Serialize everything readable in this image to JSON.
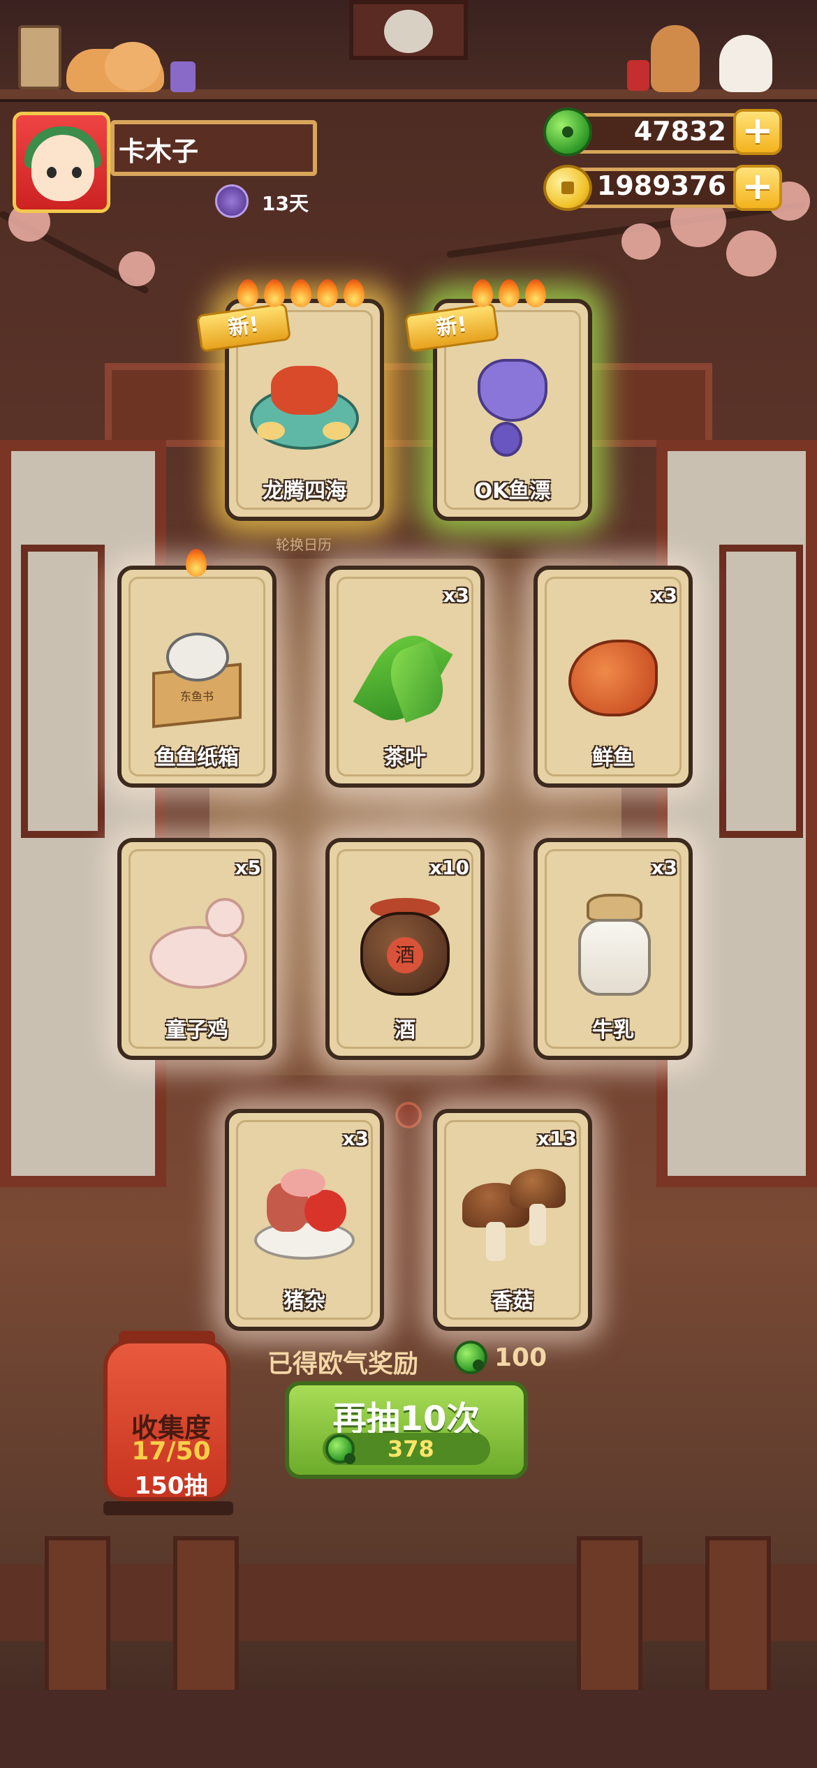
{
  "profile": {
    "name": "卡木子",
    "days": "13天"
  },
  "currency": {
    "jade": "47832",
    "coins": "1989376"
  },
  "featured": [
    {
      "label": "龙腾四海",
      "badge": "新",
      "flames": 5
    },
    {
      "label": "OK鱼漂",
      "badge": "新",
      "flames": 3
    }
  ],
  "calendar_label": "轮换日历",
  "cards": [
    {
      "label": "鱼鱼纸箱",
      "qty": "",
      "flame": true
    },
    {
      "label": "茶叶",
      "qty": "x3"
    },
    {
      "label": "鲜鱼",
      "qty": "x3"
    },
    {
      "label": "童子鸡",
      "qty": "x5"
    },
    {
      "label": "酒",
      "qty": "x10"
    },
    {
      "label": "牛乳",
      "qty": "x3"
    },
    {
      "label": "猪杂",
      "qty": "x3"
    },
    {
      "label": "香菇",
      "qty": "x13"
    }
  ],
  "reward": {
    "label": "已得欧气奖励",
    "amount": "100"
  },
  "collection": {
    "title": "收集度",
    "progress": "17/50",
    "draws": "150抽"
  },
  "draw_button": {
    "label": "再抽10次",
    "cost": "378"
  },
  "box_text": "东鱼书",
  "jar_text": "酒",
  "colors": {
    "accent_green": "#6cab2a",
    "gold": "#f3b31d",
    "wood": "#6d3424"
  }
}
